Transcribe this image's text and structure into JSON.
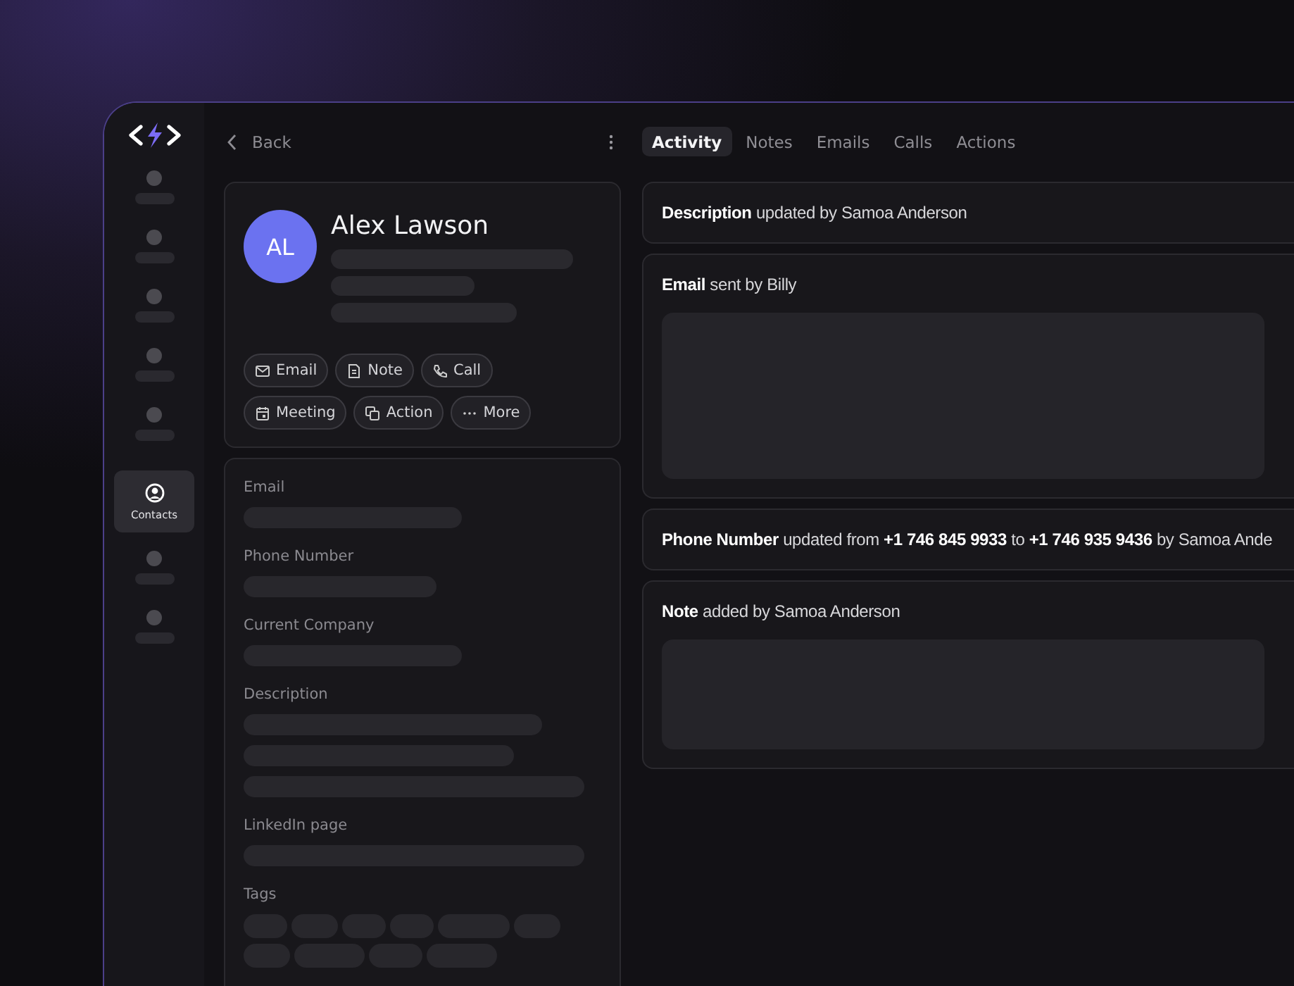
{
  "sidebar": {
    "items": [
      {
        "kind": "placeholder",
        "selected": false
      },
      {
        "kind": "placeholder",
        "selected": false
      },
      {
        "kind": "placeholder",
        "selected": false
      },
      {
        "kind": "placeholder",
        "selected": false
      },
      {
        "kind": "placeholder",
        "selected": false
      },
      {
        "kind": "labelled",
        "label": "Contacts",
        "selected": true
      },
      {
        "kind": "placeholder",
        "selected": false
      },
      {
        "kind": "placeholder",
        "selected": false
      }
    ]
  },
  "header": {
    "back": "Back"
  },
  "profile": {
    "initials": "AL",
    "name": "Alex Lawson",
    "actions": [
      "Email",
      "Note",
      "Call",
      "Meeting",
      "Action",
      "More"
    ]
  },
  "fields": [
    {
      "label": "Email"
    },
    {
      "label": "Phone Number"
    },
    {
      "label": "Current Company"
    },
    {
      "label": "Description"
    },
    {
      "label": "LinkedIn page"
    },
    {
      "label": "Tags"
    }
  ],
  "tabs": [
    {
      "label": "Activity",
      "selected": true
    },
    {
      "label": "Notes",
      "selected": false
    },
    {
      "label": "Emails",
      "selected": false
    },
    {
      "label": "Calls",
      "selected": false
    },
    {
      "label": "Actions",
      "selected": false
    }
  ],
  "activity": [
    {
      "kind": "text",
      "text": "**Description** updated by Samoa Anderson"
    },
    {
      "kind": "preview",
      "text": "**Email** sent by Billy"
    },
    {
      "kind": "text",
      "text": "**Phone Number** updated from **+1 746 845 9933** to **+1 746 935 9436** by Samoa Ande"
    },
    {
      "kind": "preview",
      "text": "**Note** added by Samoa Anderson"
    }
  ]
}
